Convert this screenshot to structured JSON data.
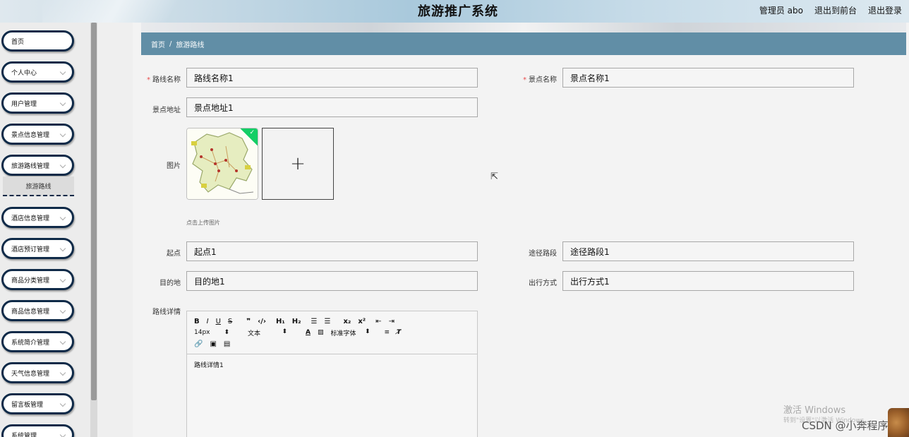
{
  "header": {
    "title": "旅游推广系统",
    "admin": "管理员 abo",
    "to_front": "退出到前台",
    "logout": "退出登录"
  },
  "sidebar": {
    "items": [
      {
        "label": "首页",
        "has_arrow": false
      },
      {
        "label": "个人中心",
        "has_arrow": true
      },
      {
        "label": "用户管理",
        "has_arrow": true
      },
      {
        "label": "景点信息管理",
        "has_arrow": true
      },
      {
        "label": "旅游路线管理",
        "has_arrow": true
      },
      {
        "label": "酒店信息管理",
        "has_arrow": true
      },
      {
        "label": "酒店预订管理",
        "has_arrow": true
      },
      {
        "label": "商品分类管理",
        "has_arrow": true
      },
      {
        "label": "商品信息管理",
        "has_arrow": true
      },
      {
        "label": "系统简介管理",
        "has_arrow": true
      },
      {
        "label": "天气信息管理",
        "has_arrow": true
      },
      {
        "label": "留言板管理",
        "has_arrow": true
      },
      {
        "label": "系统管理",
        "has_arrow": true
      }
    ],
    "active_sub": "旅游路线"
  },
  "breadcrumb": {
    "home": "首页",
    "separator": "/",
    "current": "旅游路线"
  },
  "form": {
    "route_name": {
      "label": "路线名称",
      "value": "路线名称1",
      "required": true
    },
    "scenic_name": {
      "label": "景点名称",
      "value": "景点名称1",
      "required": true
    },
    "scenic_address": {
      "label": "景点地址",
      "value": "景点地址1"
    },
    "image": {
      "label": "图片",
      "tip": "点击上传图片",
      "add_symbol": "+"
    },
    "start": {
      "label": "起点",
      "value": "起点1"
    },
    "waypoints": {
      "label": "途径路段",
      "value": "途径路段1"
    },
    "destination": {
      "label": "目的地",
      "value": "目的地1"
    },
    "travel_mode": {
      "label": "出行方式",
      "value": "出行方式1"
    },
    "details": {
      "label": "路线详情",
      "content": "路线详情1",
      "toolbar": {
        "font_size": "14px",
        "text_type": "文本",
        "font_family": "标准字体"
      }
    }
  },
  "overlay": {
    "activate_title": "激活 Windows",
    "activate_sub": "转到\"设置\"以激活 Windows。",
    "credit": "CSDN @小奔程序"
  },
  "colors": {
    "breadcrumb_bg": "#618ea6",
    "menu_border": "#0f2a48",
    "required": "#e84c4c",
    "upload_ok": "#13ce66"
  }
}
